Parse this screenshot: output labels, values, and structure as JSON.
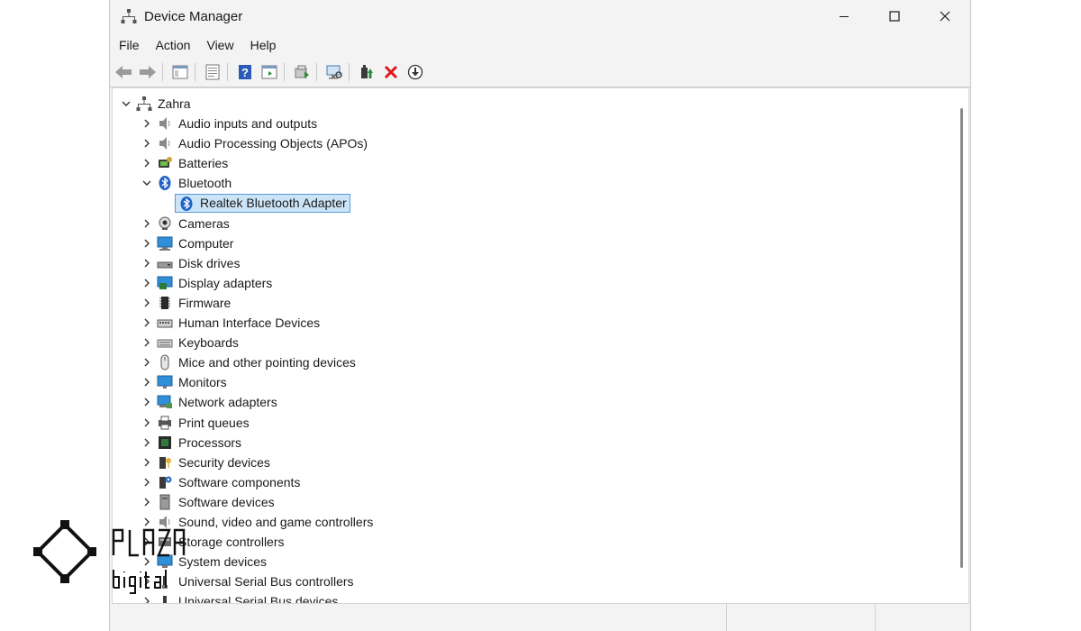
{
  "window": {
    "title": "Device Manager"
  },
  "menu": {
    "items": [
      "File",
      "Action",
      "View",
      "Help"
    ]
  },
  "toolbar": {
    "buttons": [
      {
        "icon": "back-arrow-icon"
      },
      {
        "icon": "forward-arrow-icon"
      },
      {
        "icon": "show-hide-console-tree-icon"
      },
      {
        "icon": "properties-icon"
      },
      {
        "icon": "help-icon"
      },
      {
        "icon": "action-pane-icon"
      },
      {
        "icon": "update-driver-icon"
      },
      {
        "icon": "scan-hardware-changes-icon"
      },
      {
        "icon": "enable-device-icon"
      },
      {
        "icon": "uninstall-device-icon"
      },
      {
        "icon": "download-driver-icon"
      }
    ]
  },
  "tree": {
    "root": "Zahra",
    "categories": [
      {
        "label": "Audio inputs and outputs",
        "icon": "speaker-icon",
        "expanded": false
      },
      {
        "label": "Audio Processing Objects (APOs)",
        "icon": "speaker-icon",
        "expanded": false
      },
      {
        "label": "Batteries",
        "icon": "battery-icon",
        "expanded": false
      },
      {
        "label": "Bluetooth",
        "icon": "bluetooth-icon",
        "expanded": true,
        "children": [
          "Realtek Bluetooth Adapter"
        ]
      },
      {
        "label": "Cameras",
        "icon": "camera-icon",
        "expanded": false
      },
      {
        "label": "Computer",
        "icon": "computer-icon",
        "expanded": false
      },
      {
        "label": "Disk drives",
        "icon": "disk-drive-icon",
        "expanded": false
      },
      {
        "label": "Display adapters",
        "icon": "display-adapter-icon",
        "expanded": false
      },
      {
        "label": "Firmware",
        "icon": "firmware-icon",
        "expanded": false
      },
      {
        "label": "Human Interface Devices",
        "icon": "hid-icon",
        "expanded": false
      },
      {
        "label": "Keyboards",
        "icon": "keyboard-icon",
        "expanded": false
      },
      {
        "label": "Mice and other pointing devices",
        "icon": "mouse-icon",
        "expanded": false
      },
      {
        "label": "Monitors",
        "icon": "monitor-icon",
        "expanded": false
      },
      {
        "label": "Network adapters",
        "icon": "network-adapter-icon",
        "expanded": false
      },
      {
        "label": "Print queues",
        "icon": "printer-icon",
        "expanded": false
      },
      {
        "label": "Processors",
        "icon": "processor-icon",
        "expanded": false
      },
      {
        "label": "Security devices",
        "icon": "security-device-icon",
        "expanded": false
      },
      {
        "label": "Software components",
        "icon": "software-component-icon",
        "expanded": false
      },
      {
        "label": "Software devices",
        "icon": "software-device-icon",
        "expanded": false
      },
      {
        "label": "Sound, video and game controllers",
        "icon": "speaker-icon",
        "expanded": false
      },
      {
        "label": "Storage controllers",
        "icon": "storage-controller-icon",
        "expanded": false
      },
      {
        "label": "System devices",
        "icon": "system-device-icon",
        "expanded": false
      },
      {
        "label": "Universal Serial Bus controllers",
        "icon": "usb-icon",
        "expanded": false
      },
      {
        "label": "Universal Serial Bus devices",
        "icon": "usb-icon",
        "expanded": false
      }
    ],
    "selected": "Realtek Bluetooth Adapter"
  },
  "watermark": {
    "line1": "PLAZA",
    "line2": "digital"
  }
}
